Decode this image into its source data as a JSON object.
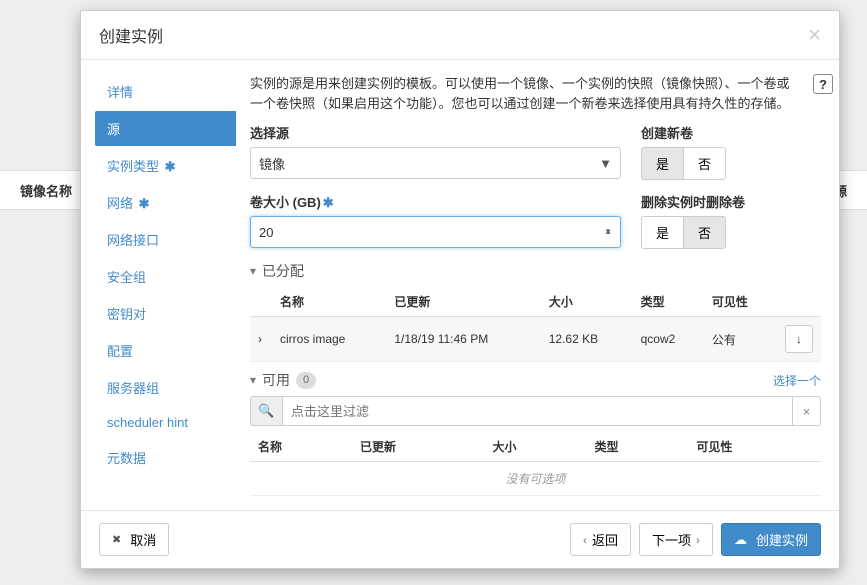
{
  "bg": {
    "col1": "镜像名称",
    "col2": "电源"
  },
  "modal": {
    "title": "创建实例",
    "close": "×",
    "help_icon": "?",
    "description": "实例的源是用来创建实例的模板。可以使用一个镜像、一个实例的快照（镜像快照）、一个卷或一个卷快照（如果启用这个功能）。您也可以通过创建一个新卷来选择使用具有持久性的存储。"
  },
  "sidebar": {
    "items": [
      {
        "label": "详情",
        "active": false,
        "required": false
      },
      {
        "label": "源",
        "active": true,
        "required": false
      },
      {
        "label": "实例类型",
        "active": false,
        "required": true
      },
      {
        "label": "网络",
        "active": false,
        "required": true
      },
      {
        "label": "网络接口",
        "active": false,
        "required": false
      },
      {
        "label": "安全组",
        "active": false,
        "required": false
      },
      {
        "label": "密钥对",
        "active": false,
        "required": false
      },
      {
        "label": "配置",
        "active": false,
        "required": false
      },
      {
        "label": "服务器组",
        "active": false,
        "required": false
      },
      {
        "label": "scheduler hint",
        "active": false,
        "required": false
      },
      {
        "label": "元数据",
        "active": false,
        "required": false
      }
    ]
  },
  "form": {
    "select_source": {
      "label": "选择源",
      "value": "镜像"
    },
    "create_volume": {
      "label": "创建新卷",
      "yes": "是",
      "no": "否",
      "value": "yes"
    },
    "volume_size": {
      "label": "卷大小 (GB)",
      "value": "20",
      "required": true
    },
    "delete_on_terminate": {
      "label": "删除实例时删除卷",
      "yes": "是",
      "no": "否",
      "value": "no"
    }
  },
  "allocated": {
    "title": "已分配",
    "chevron": "▾",
    "columns": {
      "name": "名称",
      "updated": "已更新",
      "size": "大小",
      "type": "类型",
      "visibility": "可见性"
    },
    "rows": [
      {
        "name": "cirros image",
        "updated": "1/18/19 11:46 PM",
        "size": "12.62 KB",
        "type": "qcow2",
        "visibility": "公有"
      }
    ],
    "remove_icon": "↓"
  },
  "available": {
    "title": "可用",
    "chevron": "▾",
    "count": "0",
    "select_one": "选择一个",
    "filter_placeholder": "点击这里过滤",
    "filter_clear": "×",
    "columns": {
      "name": "名称",
      "updated": "已更新",
      "size": "大小",
      "type": "类型",
      "visibility": "可见性"
    },
    "empty": "没有可选项"
  },
  "footer": {
    "cancel": "取消",
    "back": "返回",
    "next": "下一项",
    "submit": "创建实例",
    "chev_left": "‹",
    "chev_right": "›"
  }
}
